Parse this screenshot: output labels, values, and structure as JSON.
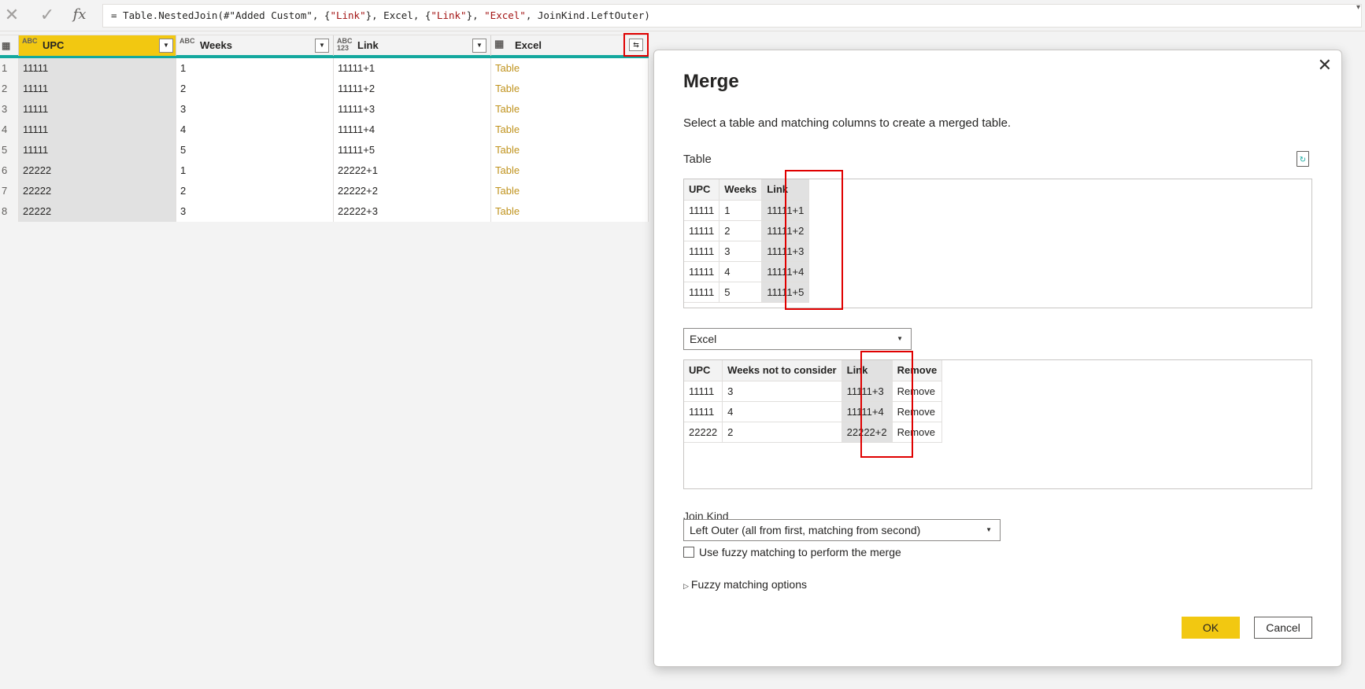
{
  "formula_bar": {
    "cancel_glyph": "✕",
    "confirm_glyph": "✓",
    "fx_label": "fx",
    "formula": {
      "p1": "= Table.NestedJoin(#\"Added Custom\", {",
      "s1": "\"Link\"",
      "p2": "}, Excel, {",
      "s2": "\"Link\"",
      "p3": "}, ",
      "s3": "\"Excel\"",
      "p4": ", JoinKind.LeftOuter)"
    }
  },
  "grid": {
    "columns": [
      {
        "type_icon": "ABC",
        "name": "UPC"
      },
      {
        "type_icon": "ABC",
        "name": "Weeks"
      },
      {
        "type_icon": "ABC 123",
        "name": "Link"
      },
      {
        "type_icon": "table",
        "name": "Excel"
      }
    ],
    "rows": [
      {
        "n": "1",
        "upc": "11111",
        "weeks": "1",
        "link": "11111+1",
        "excel": "Table"
      },
      {
        "n": "2",
        "upc": "11111",
        "weeks": "2",
        "link": "11111+2",
        "excel": "Table"
      },
      {
        "n": "3",
        "upc": "11111",
        "weeks": "3",
        "link": "11111+3",
        "excel": "Table"
      },
      {
        "n": "4",
        "upc": "11111",
        "weeks": "4",
        "link": "11111+4",
        "excel": "Table"
      },
      {
        "n": "5",
        "upc": "11111",
        "weeks": "5",
        "link": "11111+5",
        "excel": "Table"
      },
      {
        "n": "6",
        "upc": "22222",
        "weeks": "1",
        "link": "22222+1",
        "excel": "Table"
      },
      {
        "n": "7",
        "upc": "22222",
        "weeks": "2",
        "link": "22222+2",
        "excel": "Table"
      },
      {
        "n": "8",
        "upc": "22222",
        "weeks": "3",
        "link": "22222+3",
        "excel": "Table"
      }
    ]
  },
  "merge": {
    "title": "Merge",
    "description": "Select a table and matching columns to create a merged table.",
    "table_label": "Table",
    "first_table": {
      "headers": [
        "UPC",
        "Weeks",
        "Link"
      ],
      "rows": [
        [
          "11111",
          "1",
          "11111+1"
        ],
        [
          "11111",
          "2",
          "11111+2"
        ],
        [
          "11111",
          "3",
          "11111+3"
        ],
        [
          "11111",
          "4",
          "11111+4"
        ],
        [
          "11111",
          "5",
          "11111+5"
        ]
      ]
    },
    "second_select": "Excel",
    "second_table": {
      "headers": [
        "UPC",
        "Weeks not to consider",
        "Link",
        "Remove"
      ],
      "rows": [
        [
          "11111",
          "3",
          "11111+3",
          "Remove"
        ],
        [
          "11111",
          "4",
          "11111+4",
          "Remove"
        ],
        [
          "22222",
          "2",
          "22222+2",
          "Remove"
        ]
      ]
    },
    "join_kind_label": "Join Kind",
    "join_kind_value": "Left Outer (all from first, matching from second)",
    "fuzzy_checkbox_label": "Use fuzzy matching to perform the merge",
    "fuzzy_options_label": "Fuzzy matching options",
    "ok_label": "OK",
    "cancel_label": "Cancel"
  },
  "colors": {
    "accent_yellow": "#f2c811",
    "accent_teal": "#13a89e",
    "highlight_red": "#e00000",
    "table_link": "#c0931d"
  }
}
